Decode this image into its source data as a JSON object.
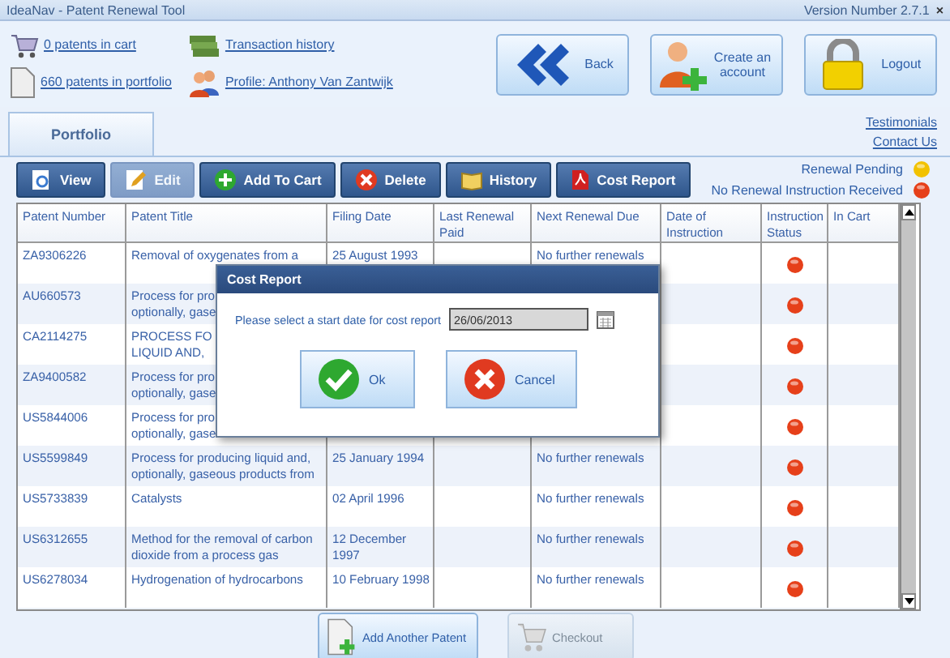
{
  "window": {
    "title": "IdeaNav - Patent Renewal Tool",
    "version": "Version Number 2.7.1",
    "close": "×"
  },
  "header_links": [
    {
      "label": "0 patents in cart"
    },
    {
      "label": "Transaction history"
    },
    {
      "label": "660 patents in portfolio"
    },
    {
      "label": "Profile: Anthony Van Zantwijk"
    }
  ],
  "header_buttons": [
    {
      "label": "Back"
    },
    {
      "label": "Create an account"
    },
    {
      "label": "Logout"
    }
  ],
  "tabs": [
    {
      "label": "Portfolio",
      "selected": true
    }
  ],
  "side_links": [
    {
      "label": "Testimonials"
    },
    {
      "label": "Contact Us"
    }
  ],
  "toolbar": [
    {
      "label": "View",
      "disabled": false
    },
    {
      "label": "Edit",
      "disabled": true
    },
    {
      "label": "Add To Cart",
      "disabled": false
    },
    {
      "label": "Delete",
      "disabled": false
    },
    {
      "label": "History",
      "disabled": false
    },
    {
      "label": "Cost Report",
      "disabled": false
    }
  ],
  "legend": [
    {
      "label": "Renewal Pending",
      "color": "#f2c200"
    },
    {
      "label": "No Renewal Instruction Received",
      "color": "#e6401a"
    }
  ],
  "table": {
    "columns": [
      "Patent Number",
      "Patent Title",
      "Filing Date",
      "Last Renewal Paid",
      "Next Renewal Due",
      "Date of Instruction",
      "Instruction Status",
      "In Cart"
    ],
    "rows": [
      {
        "number": "ZA9306226",
        "title": "Removal of oxygenates from a",
        "filing_date": "25 August 1993",
        "next_renewal": "No further renewals",
        "color": "#e6401a"
      },
      {
        "number": "AU660573",
        "title": "Process for pro\noptionally, gase",
        "filing_date": "",
        "next_renewal": "",
        "color": "#e6401a"
      },
      {
        "number": "CA2114275",
        "title": "PROCESS FO\nLIQUID AND,",
        "filing_date": "",
        "next_renewal": "",
        "color": "#e6401a"
      },
      {
        "number": "ZA9400582",
        "title": "Process for pro\noptionally, gase",
        "filing_date": "",
        "next_renewal": "",
        "color": "#e6401a"
      },
      {
        "number": "US5844006",
        "title": "Process for pro\noptionally, gase",
        "filing_date": "",
        "next_renewal": "",
        "color": "#e6401a"
      },
      {
        "number": "US5599849",
        "title": "Process for producing liquid and,\noptionally, gaseous products from",
        "filing_date": "25 January 1994",
        "next_renewal": "No further renewals",
        "color": "#e6401a"
      },
      {
        "number": "US5733839",
        "title": "Catalysts",
        "filing_date": "02 April 1996",
        "next_renewal": "No further renewals",
        "color": "#e6401a"
      },
      {
        "number": "US6312655",
        "title": "Method for the removal of carbon\ndioxide from a process gas",
        "filing_date": "12 December\n1997",
        "next_renewal": "No further renewals",
        "color": "#e6401a"
      },
      {
        "number": "US6278034",
        "title": "Hydrogenation of hydrocarbons",
        "filing_date": "10 February 1998",
        "next_renewal": "No further renewals",
        "color": "#e6401a"
      }
    ]
  },
  "bottom_buttons": [
    {
      "label": "Add Another Patent",
      "disabled": false
    },
    {
      "label": "Checkout",
      "disabled": true
    }
  ],
  "dialog": {
    "title": "Cost Report",
    "prompt": "Please select a start date for cost report",
    "date": "26/06/2013",
    "buttons": [
      "Ok",
      "Cancel"
    ]
  }
}
